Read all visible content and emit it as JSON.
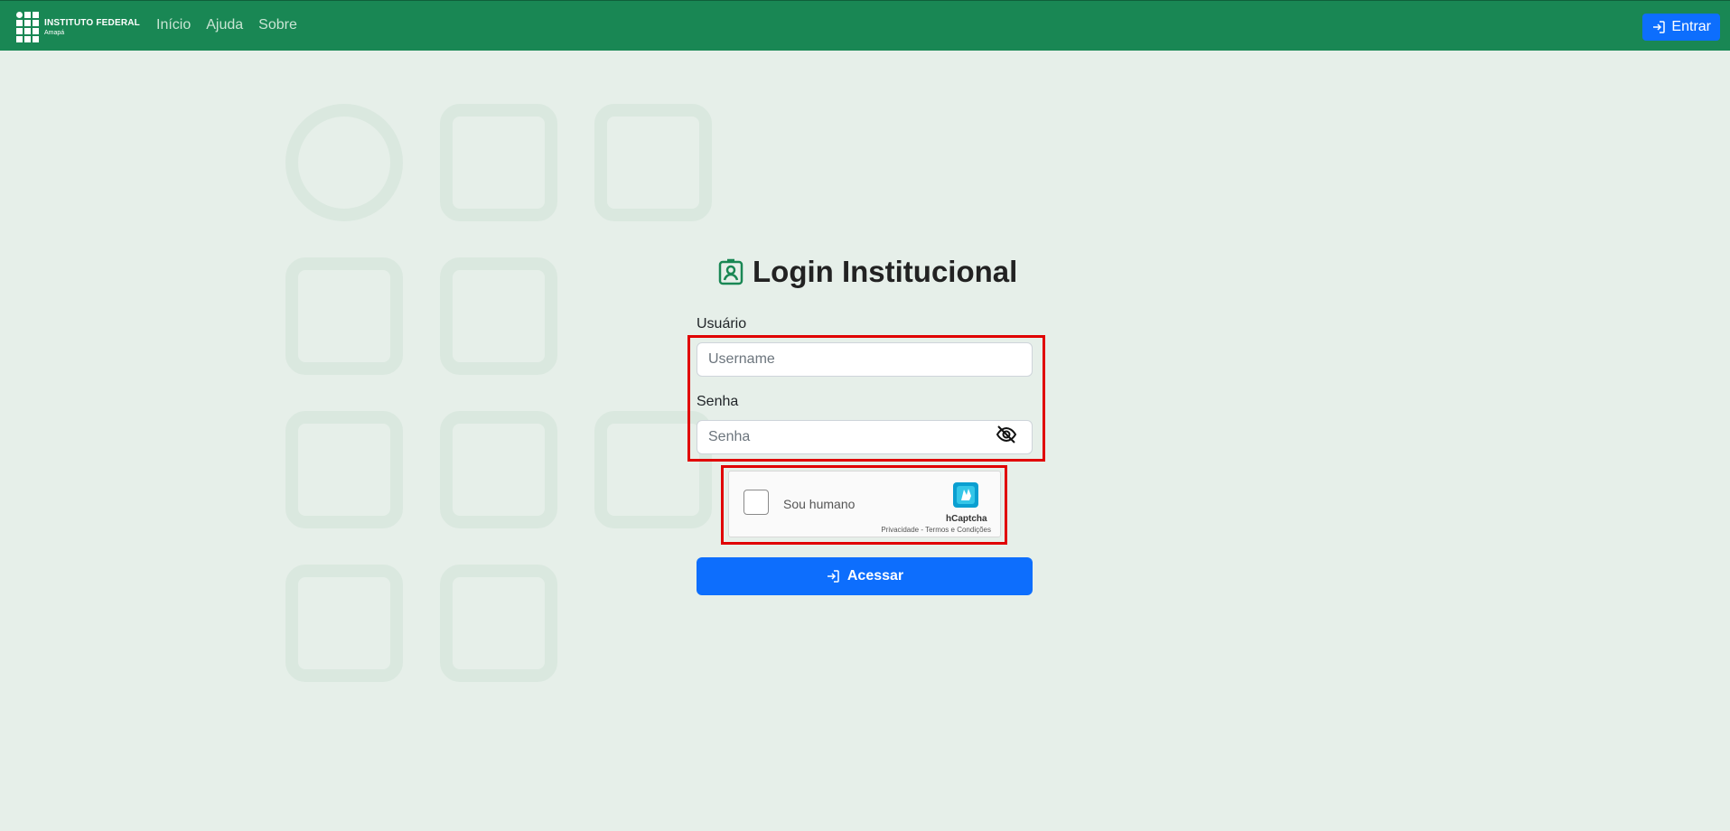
{
  "navbar": {
    "logo": {
      "title": "INSTITUTO FEDERAL",
      "subtitle": "Amapá"
    },
    "links": [
      "Início",
      "Ajuda",
      "Sobre"
    ],
    "login_button": "Entrar"
  },
  "login": {
    "title": "Login Institucional",
    "username_label": "Usuário",
    "username_placeholder": "Username",
    "password_label": "Senha",
    "password_placeholder": "Senha",
    "submit_label": "Acessar"
  },
  "captcha": {
    "checkbox_label": "Sou humano",
    "brand": "hCaptcha",
    "links": "Privacidade - Termos e Condições"
  },
  "colors": {
    "navbar": "#198754",
    "primary": "#0d6efd",
    "background": "#e6efe9",
    "highlight": "#e00000"
  }
}
